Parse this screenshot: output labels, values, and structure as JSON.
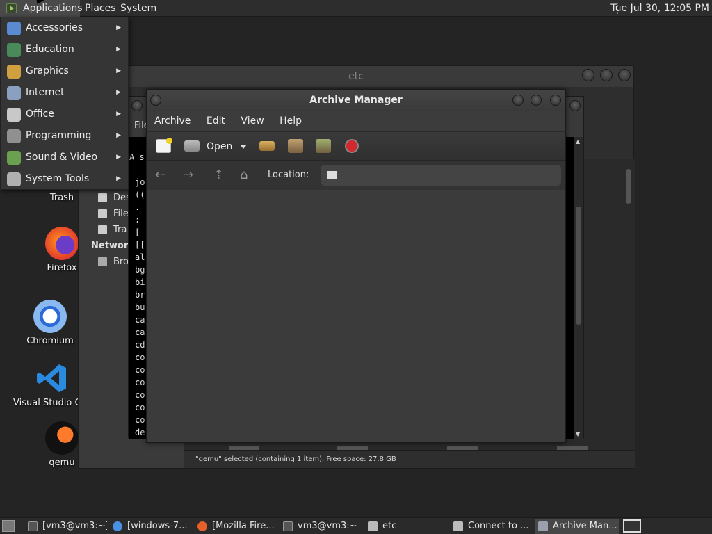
{
  "top_panel": {
    "applications": "Applications",
    "places": "Places",
    "system": "System",
    "clock": "Tue Jul 30, 12:05 PM"
  },
  "apps_menu": {
    "items": [
      {
        "label": "Accessories",
        "icon": "accessories-icon",
        "color": "#5a8ad0"
      },
      {
        "label": "Education",
        "icon": "education-icon",
        "color": "#4a8a5a"
      },
      {
        "label": "Graphics",
        "icon": "graphics-icon",
        "color": "#d0a040"
      },
      {
        "label": "Internet",
        "icon": "internet-icon",
        "color": "#8aa0c0"
      },
      {
        "label": "Office",
        "icon": "office-icon",
        "color": "#c8c8c8"
      },
      {
        "label": "Programming",
        "icon": "programming-icon",
        "color": "#909090"
      },
      {
        "label": "Sound & Video",
        "icon": "sound-video-icon",
        "color": "#6aa050"
      },
      {
        "label": "System Tools",
        "icon": "system-tools-icon",
        "color": "#b0b0b0"
      }
    ]
  },
  "desktop": {
    "icons": [
      {
        "label": "Trash"
      },
      {
        "label": "Firefox"
      },
      {
        "label": "Chromium"
      },
      {
        "label": "Visual Studio Co"
      },
      {
        "label": "qemu"
      }
    ]
  },
  "file_manager": {
    "title": "etc",
    "menu_first": "File",
    "sidebar": {
      "items": [
        "Des",
        "File",
        "Tra"
      ],
      "network_heading": "Network",
      "network_items": [
        "Bro"
      ]
    },
    "status": "\"qemu\" selected (containing 1 item), Free space: 27.8 GB"
  },
  "terminal": {
    "menu_first": "File",
    "lines": [
      "A s",
      "",
      "jo",
      "((",
      ".",
      ":",
      "[ ",
      "[[",
      "al",
      "bg",
      "bi",
      "br",
      "bu",
      "ca",
      "ca",
      "cd",
      "co",
      "co",
      "co",
      "co",
      "co",
      "co",
      "de"
    ]
  },
  "archive_manager": {
    "title": "Archive Manager",
    "menu": [
      "Archive",
      "Edit",
      "View",
      "Help"
    ],
    "toolbar": {
      "open_label": "Open"
    },
    "location_label": "Location:"
  },
  "taskbar": {
    "items": [
      {
        "label": "[vm3@vm3:~]",
        "icon": "terminal-icon"
      },
      {
        "label": "[windows-7...",
        "icon": "chromium-icon"
      },
      {
        "label": "[Mozilla Fire...",
        "icon": "firefox-icon"
      },
      {
        "label": "vm3@vm3:~",
        "icon": "terminal-icon"
      },
      {
        "label": "etc",
        "icon": "folder-icon"
      },
      {
        "label": "Connect to ...",
        "icon": "folder-icon"
      },
      {
        "label": "Archive Man...",
        "icon": "archive-manager-icon"
      }
    ]
  },
  "colors": {
    "panel_bg": "#2d2d2d",
    "desktop_bg": "#242424",
    "menu_highlight": "#4a4a4a",
    "record_red": "#c0202a"
  }
}
